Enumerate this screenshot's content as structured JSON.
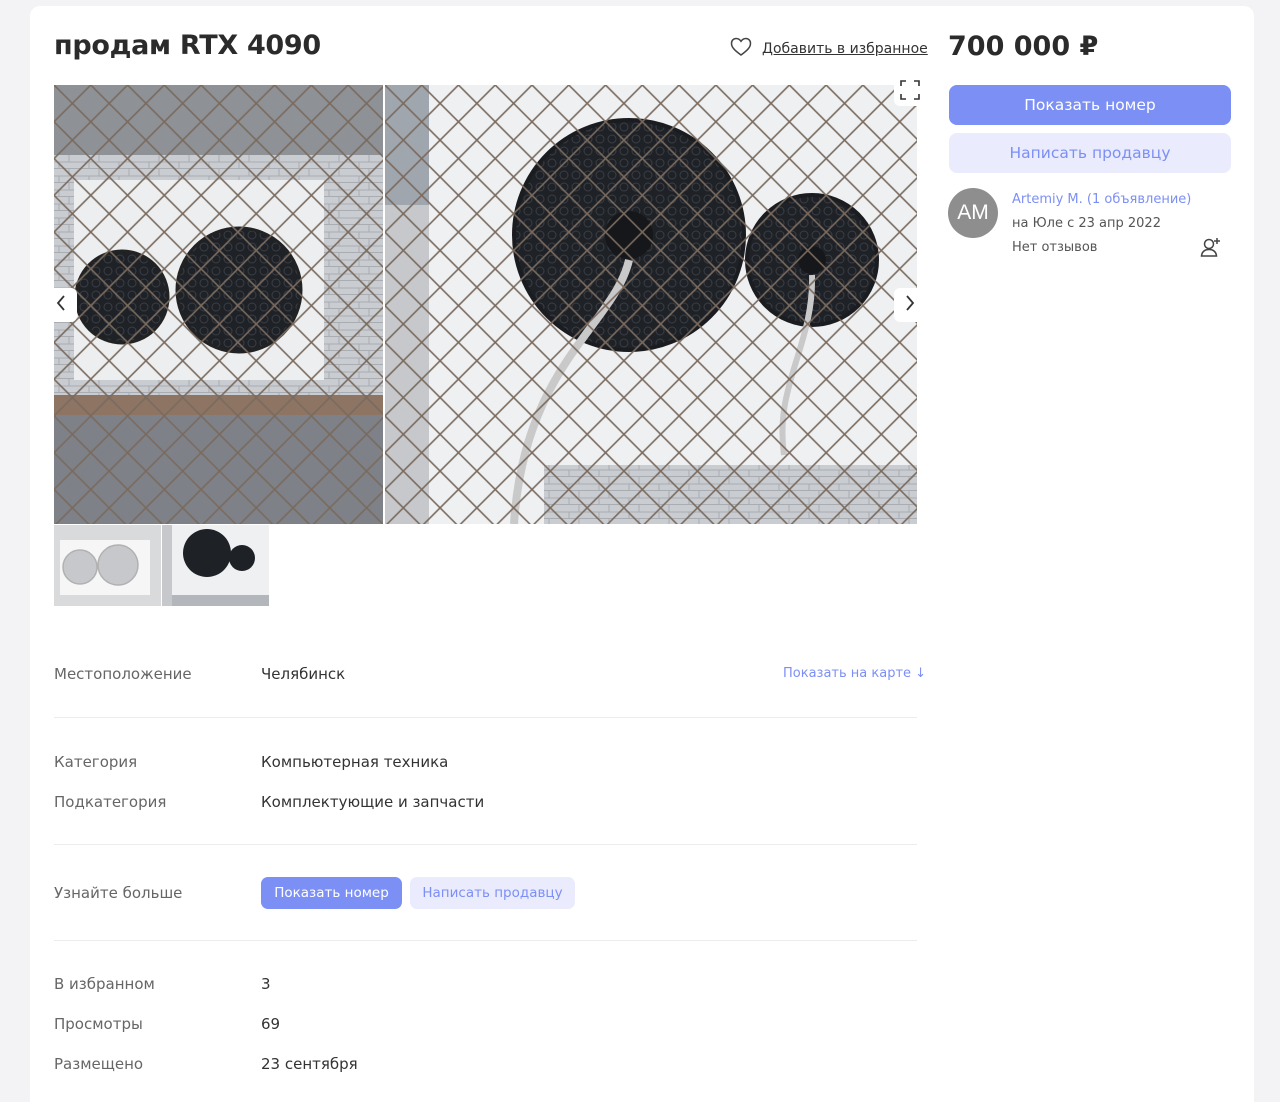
{
  "listing": {
    "title": "продам RTX 4090",
    "favorite_label": "Добавить в избранное",
    "price": "700 000 ₽"
  },
  "gallery": {
    "expand_icon": "expand-icon",
    "prev_icon": "chevron-left-icon",
    "next_icon": "chevron-right-icon"
  },
  "sidebar": {
    "show_number_label": "Показать номер",
    "message_seller_label": "Написать продавцу"
  },
  "seller": {
    "initials": "AM",
    "name": "Artemiy M. (1 объявление)",
    "since": "на Юле с 23 апр 2022",
    "reviews": "Нет отзывов"
  },
  "details": {
    "location": {
      "label": "Местоположение",
      "value": "Челябинск",
      "map_link": "Показать на карте ↓"
    },
    "category": {
      "label": "Категория",
      "value": "Компьютерная техника"
    },
    "subcategory": {
      "label": "Подкатегория",
      "value": "Комплектующие и запчасти"
    },
    "learn_more": {
      "label": "Узнайте больше",
      "show_number": "Показать номер",
      "message_seller": "Написать продавцу"
    }
  },
  "stats": {
    "favorites": {
      "label": "В избранном",
      "value": "3"
    },
    "views": {
      "label": "Просмотры",
      "value": "69"
    },
    "posted": {
      "label": "Размещено",
      "value": "23 сентября"
    }
  },
  "colors": {
    "accent": "#7c8ff5",
    "accent_light": "#eaecfd",
    "avatar_bg": "#8e8e8e"
  }
}
